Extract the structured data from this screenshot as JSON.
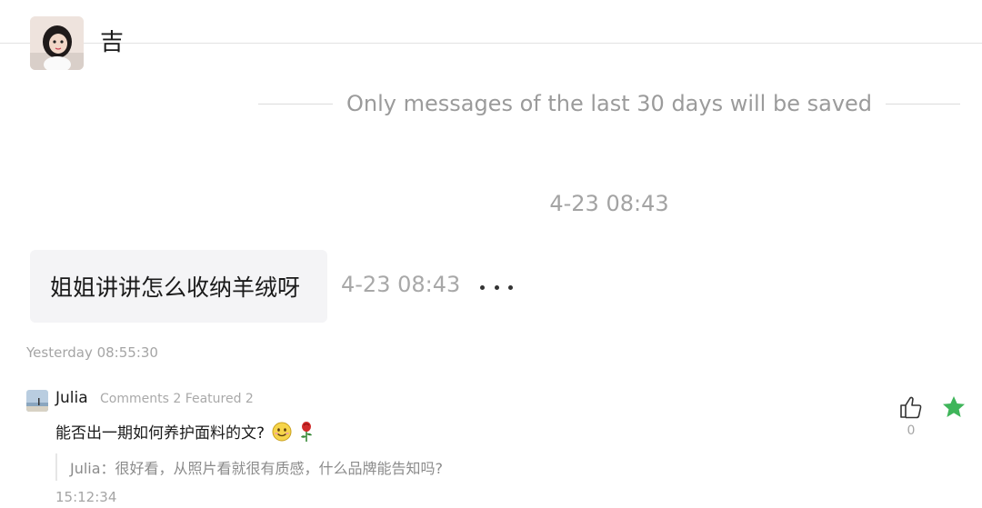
{
  "header": {
    "contact_name": "吉"
  },
  "notice": {
    "text": "Only messages of the last 30 days will be saved"
  },
  "chat": {
    "center_timestamp": "4-23 08:43",
    "message": {
      "text": "姐姐讲讲怎么收纳羊绒呀",
      "time": "4-23 08:43"
    }
  },
  "comment_section": {
    "section_time": "Yesterday 08:55:30",
    "comment": {
      "user": "Julia",
      "meta": "Comments 2 Featured 2",
      "text": "能否出一期如何养护面料的文?",
      "emojis": [
        "smile-emoji",
        "rose-emoji"
      ],
      "reply": "Julia：很好看，从照片看就很有质感，什么品牌能告知吗?",
      "time": "15:12:34",
      "like_count": "0"
    }
  },
  "colors": {
    "star": "#3fb55a",
    "bubble_bg": "#f4f4f6",
    "muted_text": "#a3a3a3"
  }
}
